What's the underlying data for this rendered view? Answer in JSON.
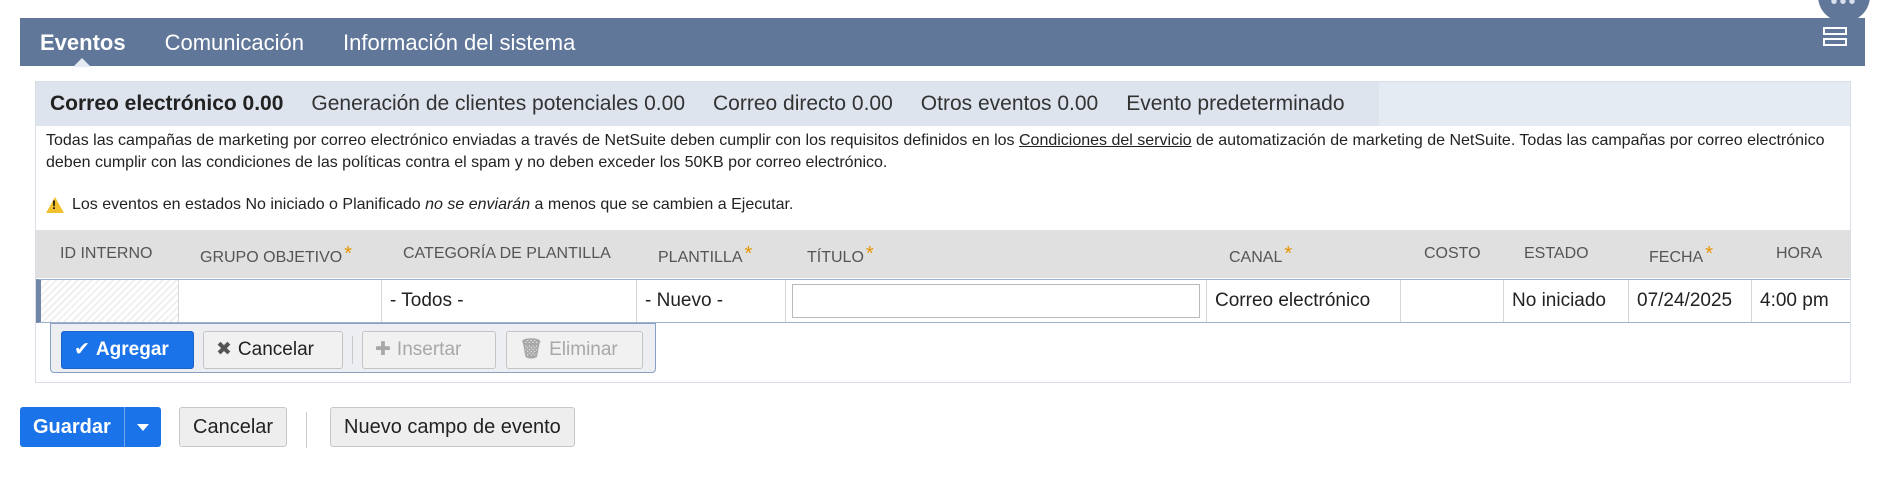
{
  "top_tabs": [
    "Eventos",
    "Comunicación",
    "Información del sistema"
  ],
  "sub_tabs": [
    "Correo electrónico 0.00",
    "Generación de clientes potenciales 0.00",
    "Correo directo 0.00",
    "Otros eventos 0.00",
    "Evento predeterminado"
  ],
  "notice": {
    "text_before": "Todas las campañas de marketing por correo electrónico enviadas a través de NetSuite deben cumplir con los requisitos definidos en los ",
    "link": "Condiciones del servicio",
    "text_after": " de automatización de marketing de NetSuite. Todas las campañas por correo electrónico deben cumplir con las condiciones de las políticas contra el spam y no deben exceder los 50KB por correo electrónico."
  },
  "warning": {
    "before": "Los eventos en estados No iniciado o Planificado ",
    "emph": "no se enviarán",
    "after": " a menos que se cambien a Ejecutar."
  },
  "columns": [
    "ID INTERNO",
    "GRUPO OBJETIVO",
    "CATEGORÍA DE PLANTILLA",
    "PLANTILLA",
    "TÍTULO",
    "CANAL",
    "COSTO",
    "ESTADO",
    "FECHA",
    "HORA"
  ],
  "required_mark": "*",
  "row": {
    "id": "",
    "grupo": "",
    "categoria": "- Todos -",
    "plantilla": "- Nuevo -",
    "titulo": "",
    "canal": "Correo electrónico",
    "costo": "",
    "estado": "No iniciado",
    "fecha": "07/24/2025",
    "hora": "4:00 pm"
  },
  "row_buttons": {
    "add": "Agregar",
    "cancel": "Cancelar",
    "insert": "Insertar",
    "delete": "Eliminar"
  },
  "bottom_buttons": {
    "save": "Guardar",
    "cancel": "Cancelar",
    "new_field": "Nuevo campo de evento"
  },
  "icons": {
    "menu": "hamburger-icon",
    "more": "ellipsis-icon",
    "warning": "warning-triangle-icon"
  },
  "colors": {
    "header": "#607799",
    "primary": "#1a73e8",
    "required": "#e69400"
  }
}
